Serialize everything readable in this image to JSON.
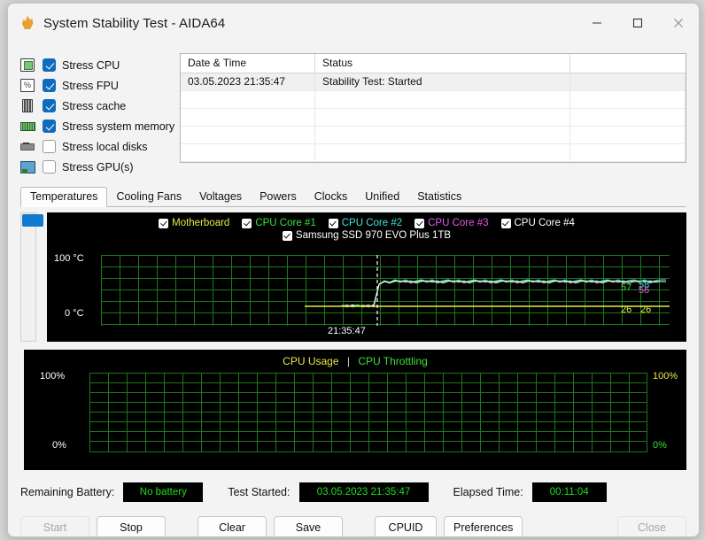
{
  "window": {
    "title": "System Stability Test - AIDA64",
    "icon": "flame-icon",
    "minimize": "minimize-icon",
    "maximize": "maximize-icon",
    "close": "close-icon"
  },
  "stress_options": [
    {
      "label": "Stress CPU",
      "checked": true,
      "icon": "cpu-icon"
    },
    {
      "label": "Stress FPU",
      "checked": true,
      "icon": "fpu-icon"
    },
    {
      "label": "Stress cache",
      "checked": true,
      "icon": "cache-icon"
    },
    {
      "label": "Stress system memory",
      "checked": true,
      "icon": "memory-icon"
    },
    {
      "label": "Stress local disks",
      "checked": false,
      "icon": "disk-icon"
    },
    {
      "label": "Stress GPU(s)",
      "checked": false,
      "icon": "gpu-icon"
    }
  ],
  "log_table": {
    "columns": [
      "Date & Time",
      "Status"
    ],
    "rows": [
      {
        "datetime": "03.05.2023 21:35:47",
        "status": "Stability Test: Started"
      }
    ],
    "empty_rows": 4
  },
  "tabs": [
    {
      "label": "Temperatures",
      "active": true
    },
    {
      "label": "Cooling Fans",
      "active": false
    },
    {
      "label": "Voltages",
      "active": false
    },
    {
      "label": "Powers",
      "active": false
    },
    {
      "label": "Clocks",
      "active": false
    },
    {
      "label": "Unified",
      "active": false
    },
    {
      "label": "Statistics",
      "active": false
    }
  ],
  "chart_data": [
    {
      "id": "temperature-chart",
      "type": "line",
      "title": "",
      "ylabel_top": "100 °C",
      "ylabel_bottom": "0 °C",
      "ylim": [
        0,
        100
      ],
      "time_marker_label": "21:35:47",
      "grid": true,
      "grid_color": "#1f8a1f",
      "background": "#000000",
      "legend_position": "top",
      "legend": [
        {
          "name": "Motherboard",
          "color": "#e8e84a",
          "checked": true
        },
        {
          "name": "CPU Core #1",
          "color": "#3ce03c",
          "checked": true
        },
        {
          "name": "CPU Core #2",
          "color": "#44e0e0",
          "checked": true
        },
        {
          "name": "CPU Core #3",
          "color": "#e85ce8",
          "checked": true
        },
        {
          "name": "CPU Core #4",
          "color": "#ffffff",
          "checked": true
        },
        {
          "name": "Samsung SSD 970 EVO Plus 1TB",
          "color": "#ffffff",
          "checked": true
        }
      ],
      "right_value_labels": [
        {
          "text": "57",
          "color": "#3ce03c"
        },
        {
          "text": "58",
          "color": "#44e0e0"
        },
        {
          "text": "56",
          "color": "#e85ce8"
        },
        {
          "text": "26",
          "color": "#e8e84a"
        },
        {
          "text": "26",
          "color": "#e8e84a"
        }
      ],
      "series": [
        {
          "name": "Motherboard",
          "color": "#e8e84a",
          "values": [
            26,
            26,
            26,
            26,
            26,
            26,
            26,
            26,
            26,
            26,
            26,
            26,
            26,
            26,
            26,
            26,
            26,
            26,
            26,
            26,
            26,
            26,
            26,
            26,
            26,
            26,
            26,
            26,
            26,
            26,
            26,
            26
          ]
        },
        {
          "name": "CPU Core #1",
          "color": "#3ce03c",
          "values": [
            27,
            26,
            28,
            27,
            29,
            27,
            26,
            27,
            26,
            27,
            44,
            53,
            55,
            56,
            57,
            56,
            58,
            57,
            56,
            57,
            58,
            57,
            56,
            57,
            58,
            57,
            56,
            57,
            58,
            57,
            57,
            57
          ]
        },
        {
          "name": "CPU Core #2",
          "color": "#44e0e0",
          "values": [
            27,
            28,
            27,
            29,
            28,
            27,
            28,
            27,
            28,
            27,
            46,
            54,
            56,
            57,
            58,
            57,
            59,
            58,
            57,
            58,
            59,
            58,
            57,
            58,
            59,
            58,
            57,
            58,
            59,
            58,
            58,
            58
          ]
        },
        {
          "name": "CPU Core #3",
          "color": "#e85ce8",
          "values": [
            26,
            27,
            26,
            28,
            27,
            26,
            27,
            26,
            27,
            26,
            43,
            52,
            54,
            55,
            56,
            55,
            57,
            56,
            55,
            56,
            57,
            56,
            55,
            56,
            57,
            56,
            55,
            56,
            57,
            56,
            56,
            56
          ]
        },
        {
          "name": "CPU Core #4",
          "color": "#ffffff",
          "values": [
            27,
            27,
            28,
            27,
            28,
            28,
            27,
            28,
            27,
            28,
            45,
            53,
            55,
            56,
            57,
            57,
            58,
            57,
            57,
            57,
            58,
            58,
            57,
            57,
            58,
            58,
            57,
            57,
            58,
            58,
            57,
            57
          ]
        },
        {
          "name": "Samsung SSD 970 EVO Plus 1TB",
          "color": "#ffffff",
          "values": [
            26,
            26,
            26,
            26,
            26,
            26,
            26,
            26,
            26,
            26,
            26,
            26,
            26,
            26,
            26,
            26,
            26,
            26,
            26,
            26,
            26,
            26,
            26,
            26,
            26,
            26,
            26,
            26,
            26,
            26,
            26,
            26
          ]
        }
      ]
    },
    {
      "id": "cpu-usage-chart",
      "type": "line",
      "title_parts": [
        {
          "text": "CPU Usage",
          "color": "#e8e84a"
        },
        {
          "text": "|",
          "color": "#cccccc"
        },
        {
          "text": "CPU Throttling",
          "color": "#3ce03c"
        }
      ],
      "ylabel_top_left": "100%",
      "ylabel_bottom_left": "0%",
      "ylabel_top_right": "100%",
      "ylabel_bottom_right": "0%",
      "ylim": [
        0,
        100
      ],
      "grid": true,
      "grid_color": "#1f8a1f",
      "background": "#000000",
      "series": [
        {
          "name": "CPU Usage",
          "color": "#e8e84a",
          "values": []
        },
        {
          "name": "CPU Throttling",
          "color": "#3ce03c",
          "values": []
        }
      ]
    }
  ],
  "status": {
    "battery_label": "Remaining Battery:",
    "battery_value": "No battery",
    "started_label": "Test Started:",
    "started_value": "03.05.2023 21:35:47",
    "elapsed_label": "Elapsed Time:",
    "elapsed_value": "00:11:04"
  },
  "buttons": [
    {
      "label": "Start",
      "disabled": true
    },
    {
      "label": "Stop",
      "disabled": false
    },
    {
      "label": "Clear",
      "disabled": false
    },
    {
      "label": "Save",
      "disabled": false
    },
    {
      "label": "CPUID",
      "disabled": false
    },
    {
      "label": "Preferences",
      "disabled": false
    },
    {
      "label": "Close",
      "disabled": true
    }
  ]
}
